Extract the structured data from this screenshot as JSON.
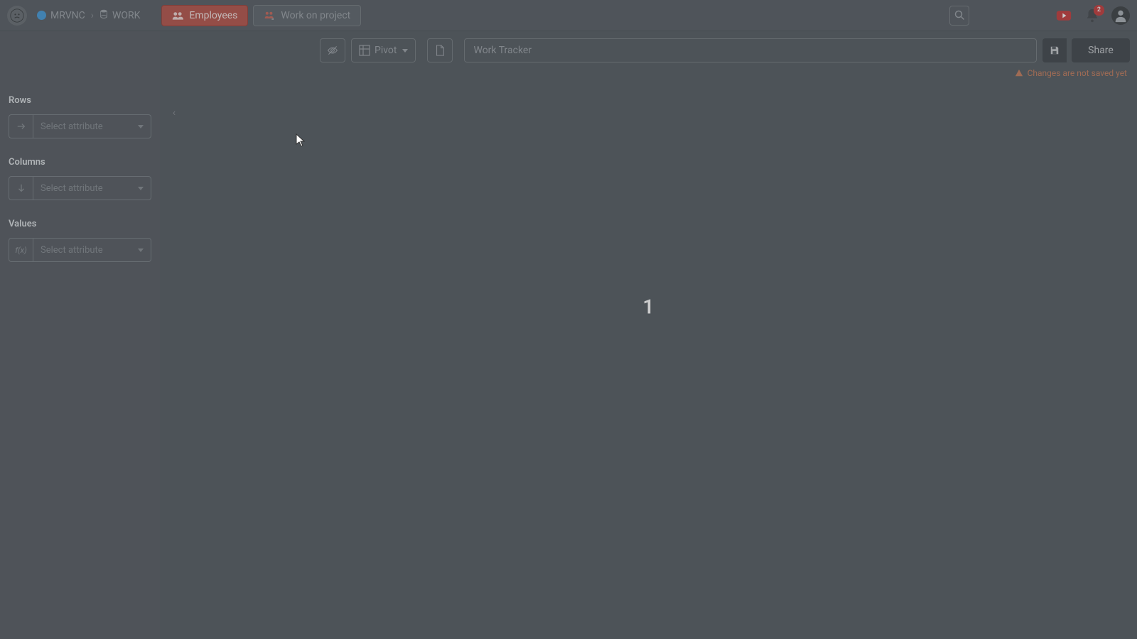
{
  "breadcrumb": {
    "org": "MRVNC",
    "project": "WORK"
  },
  "tabs": [
    {
      "label": "Employees",
      "active": true
    },
    {
      "label": "Work on project",
      "active": false
    }
  ],
  "toolbar": {
    "view_mode": "Pivot",
    "report_name": "Work Tracker",
    "share_label": "Share"
  },
  "warn_message": "Changes are not saved yet",
  "sidebar": {
    "rows_title": "Rows",
    "columns_title": "Columns",
    "values_title": "Values",
    "placeholder": "Select attribute",
    "values_fn_label": "f(x)"
  },
  "content": {
    "value": "1"
  },
  "notifications_count": "2"
}
